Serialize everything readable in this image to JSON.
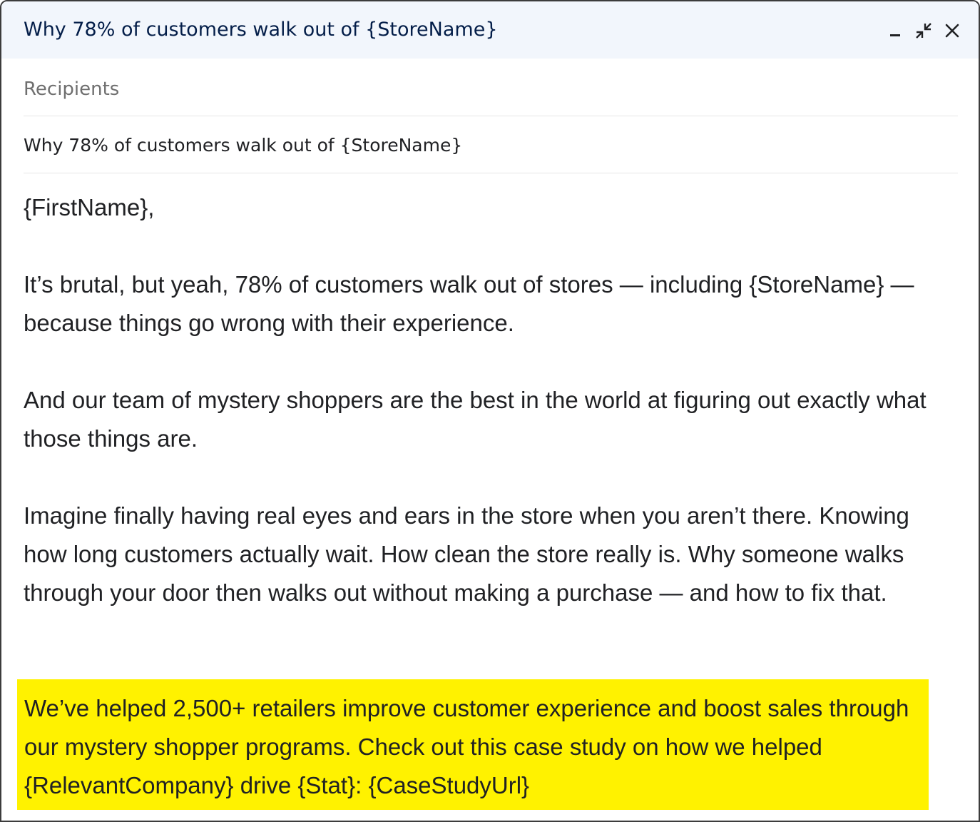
{
  "window": {
    "title": "Why 78% of customers walk out of {StoreName}",
    "controls": {
      "minimize_icon": "minimize-icon",
      "exit_fullscreen_icon": "exit-fullscreen-icon",
      "close_icon": "close-icon"
    }
  },
  "compose": {
    "recipients_placeholder": "Recipients",
    "subject": "Why 78% of customers walk out of {StoreName}"
  },
  "body": {
    "greeting": "{FirstName},",
    "paragraph_1": "It’s brutal, but yeah, 78% of customers walk out of stores — including {StoreName} — because things go wrong with their experience.",
    "paragraph_2": "And our team of mystery shoppers are the best in the world at figuring out exactly what those things are.",
    "paragraph_3": "Imagine finally having real eyes and ears in the store when you aren’t there. Knowing how long customers actually wait. How clean the store really is. Why someone walks through your door then walks out without making a purchase — and how to fix that.",
    "highlighted_paragraph": "We’ve helped 2,500+ retailers improve customer experience and boost sales through our mystery shopper programs. Check out this case study on how we helped {RelevantCompany} drive {Stat}: {CaseStudyUrl}"
  },
  "colors": {
    "titlebar_bg": "#f2f6fc",
    "title_text": "#041e49",
    "highlight": "#fff200"
  }
}
